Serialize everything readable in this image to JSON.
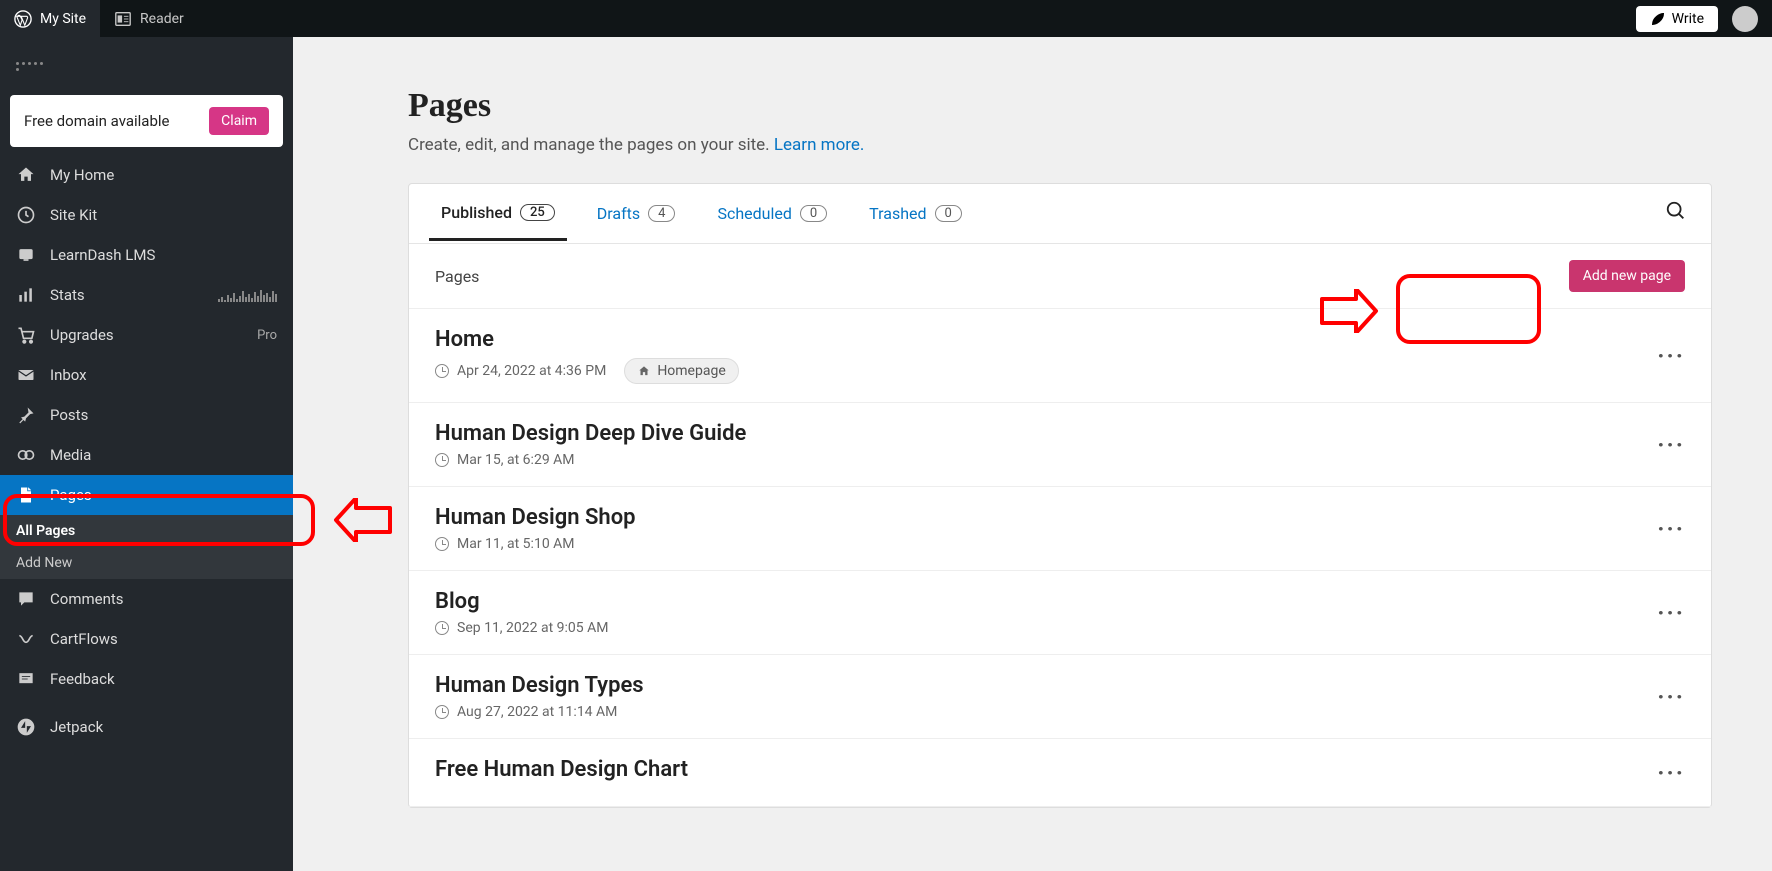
{
  "topbar": {
    "mysite": "My Site",
    "reader": "Reader",
    "write": "Write"
  },
  "sidebar": {
    "domain_text": "Free domain available",
    "claim_btn": "Claim",
    "items": [
      {
        "label": "My Home"
      },
      {
        "label": "Site Kit"
      },
      {
        "label": "LearnDash LMS"
      },
      {
        "label": "Stats"
      },
      {
        "label": "Upgrades",
        "badge": "Pro"
      },
      {
        "label": "Inbox"
      },
      {
        "label": "Posts"
      },
      {
        "label": "Media"
      },
      {
        "label": "Pages"
      },
      {
        "label": "Comments"
      },
      {
        "label": "CartFlows"
      },
      {
        "label": "Feedback"
      },
      {
        "label": "Jetpack"
      }
    ],
    "sub": {
      "all_pages": "All Pages",
      "add_new": "Add New"
    }
  },
  "main": {
    "title": "Pages",
    "subtitle_pre": "Create, edit, and manage the pages on your site. ",
    "learn_more": "Learn more.",
    "tabs": [
      {
        "label": "Published",
        "count": "25"
      },
      {
        "label": "Drafts",
        "count": "4"
      },
      {
        "label": "Scheduled",
        "count": "0"
      },
      {
        "label": "Trashed",
        "count": "0"
      }
    ],
    "list_header": "Pages",
    "add_btn": "Add new page",
    "rows": [
      {
        "title": "Home",
        "date": "Apr 24, 2022 at 4:36 PM",
        "homepage": "Homepage"
      },
      {
        "title": "Human Design Deep Dive Guide",
        "date": "Mar 15, at 6:29 AM"
      },
      {
        "title": "Human Design Shop",
        "date": "Mar 11, at 5:10 AM"
      },
      {
        "title": "Blog",
        "date": "Sep 11, 2022 at 9:05 AM"
      },
      {
        "title": "Human Design Types",
        "date": "Aug 27, 2022 at 11:14 AM"
      },
      {
        "title": "Free Human Design Chart",
        "date": ""
      }
    ]
  }
}
